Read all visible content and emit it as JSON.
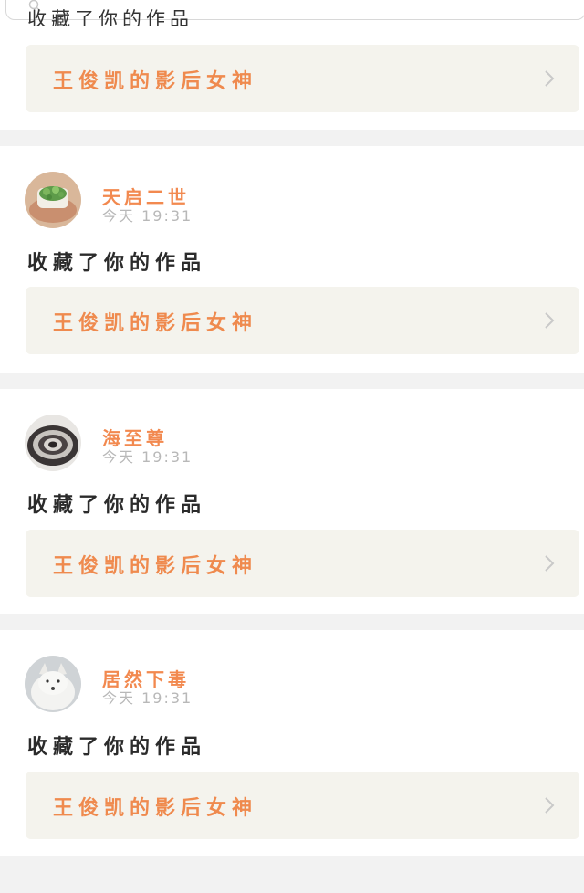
{
  "top": {
    "cut_text": "收藏了你的作品"
  },
  "notifications": [
    {
      "work_title": "王俊凯的影后女神"
    },
    {
      "username": "天启二世",
      "time": "今天 19:31",
      "action": "收藏了你的作品",
      "work_title": "王俊凯的影后女神",
      "avatar_icon": "avatar-plant-icon"
    },
    {
      "username": "海至尊",
      "time": "今天 19:31",
      "action": "收藏了你的作品",
      "work_title": "王俊凯的影后女神",
      "avatar_icon": "avatar-swirl-icon"
    },
    {
      "username": "居然下毒",
      "time": "今天 19:31",
      "action": "收藏了你的作品",
      "work_title": "王俊凯的影后女神",
      "avatar_icon": "avatar-fox-icon"
    }
  ],
  "colors": {
    "accent": "#ef8a4e",
    "work_bg": "#f4f3ed",
    "gap_bg": "#f2f2f2"
  }
}
